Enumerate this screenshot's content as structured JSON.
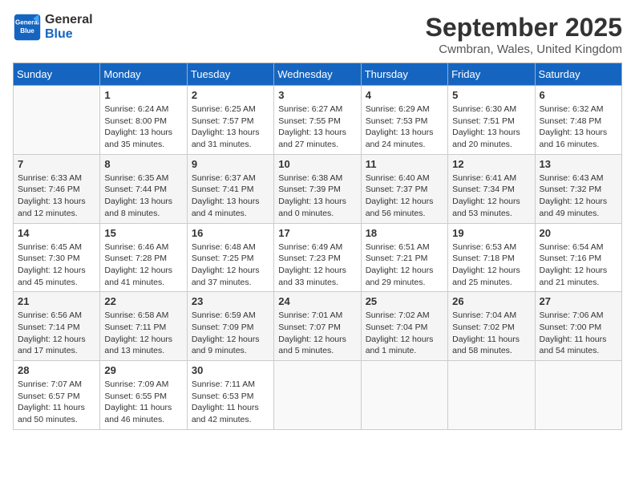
{
  "logo": {
    "line1": "General",
    "line2": "Blue"
  },
  "title": "September 2025",
  "location": "Cwmbran, Wales, United Kingdom",
  "days_of_week": [
    "Sunday",
    "Monday",
    "Tuesday",
    "Wednesday",
    "Thursday",
    "Friday",
    "Saturday"
  ],
  "weeks": [
    [
      {
        "day": "",
        "empty": true
      },
      {
        "day": "1",
        "sunrise": "6:24 AM",
        "sunset": "8:00 PM",
        "daylight": "13 hours and 35 minutes."
      },
      {
        "day": "2",
        "sunrise": "6:25 AM",
        "sunset": "7:57 PM",
        "daylight": "13 hours and 31 minutes."
      },
      {
        "day": "3",
        "sunrise": "6:27 AM",
        "sunset": "7:55 PM",
        "daylight": "13 hours and 27 minutes."
      },
      {
        "day": "4",
        "sunrise": "6:29 AM",
        "sunset": "7:53 PM",
        "daylight": "13 hours and 24 minutes."
      },
      {
        "day": "5",
        "sunrise": "6:30 AM",
        "sunset": "7:51 PM",
        "daylight": "13 hours and 20 minutes."
      },
      {
        "day": "6",
        "sunrise": "6:32 AM",
        "sunset": "7:48 PM",
        "daylight": "13 hours and 16 minutes."
      }
    ],
    [
      {
        "day": "7",
        "sunrise": "6:33 AM",
        "sunset": "7:46 PM",
        "daylight": "13 hours and 12 minutes."
      },
      {
        "day": "8",
        "sunrise": "6:35 AM",
        "sunset": "7:44 PM",
        "daylight": "13 hours and 8 minutes."
      },
      {
        "day": "9",
        "sunrise": "6:37 AM",
        "sunset": "7:41 PM",
        "daylight": "13 hours and 4 minutes."
      },
      {
        "day": "10",
        "sunrise": "6:38 AM",
        "sunset": "7:39 PM",
        "daylight": "13 hours and 0 minutes."
      },
      {
        "day": "11",
        "sunrise": "6:40 AM",
        "sunset": "7:37 PM",
        "daylight": "12 hours and 56 minutes."
      },
      {
        "day": "12",
        "sunrise": "6:41 AM",
        "sunset": "7:34 PM",
        "daylight": "12 hours and 53 minutes."
      },
      {
        "day": "13",
        "sunrise": "6:43 AM",
        "sunset": "7:32 PM",
        "daylight": "12 hours and 49 minutes."
      }
    ],
    [
      {
        "day": "14",
        "sunrise": "6:45 AM",
        "sunset": "7:30 PM",
        "daylight": "12 hours and 45 minutes."
      },
      {
        "day": "15",
        "sunrise": "6:46 AM",
        "sunset": "7:28 PM",
        "daylight": "12 hours and 41 minutes."
      },
      {
        "day": "16",
        "sunrise": "6:48 AM",
        "sunset": "7:25 PM",
        "daylight": "12 hours and 37 minutes."
      },
      {
        "day": "17",
        "sunrise": "6:49 AM",
        "sunset": "7:23 PM",
        "daylight": "12 hours and 33 minutes."
      },
      {
        "day": "18",
        "sunrise": "6:51 AM",
        "sunset": "7:21 PM",
        "daylight": "12 hours and 29 minutes."
      },
      {
        "day": "19",
        "sunrise": "6:53 AM",
        "sunset": "7:18 PM",
        "daylight": "12 hours and 25 minutes."
      },
      {
        "day": "20",
        "sunrise": "6:54 AM",
        "sunset": "7:16 PM",
        "daylight": "12 hours and 21 minutes."
      }
    ],
    [
      {
        "day": "21",
        "sunrise": "6:56 AM",
        "sunset": "7:14 PM",
        "daylight": "12 hours and 17 minutes."
      },
      {
        "day": "22",
        "sunrise": "6:58 AM",
        "sunset": "7:11 PM",
        "daylight": "12 hours and 13 minutes."
      },
      {
        "day": "23",
        "sunrise": "6:59 AM",
        "sunset": "7:09 PM",
        "daylight": "12 hours and 9 minutes."
      },
      {
        "day": "24",
        "sunrise": "7:01 AM",
        "sunset": "7:07 PM",
        "daylight": "12 hours and 5 minutes."
      },
      {
        "day": "25",
        "sunrise": "7:02 AM",
        "sunset": "7:04 PM",
        "daylight": "12 hours and 1 minute."
      },
      {
        "day": "26",
        "sunrise": "7:04 AM",
        "sunset": "7:02 PM",
        "daylight": "11 hours and 58 minutes."
      },
      {
        "day": "27",
        "sunrise": "7:06 AM",
        "sunset": "7:00 PM",
        "daylight": "11 hours and 54 minutes."
      }
    ],
    [
      {
        "day": "28",
        "sunrise": "7:07 AM",
        "sunset": "6:57 PM",
        "daylight": "11 hours and 50 minutes."
      },
      {
        "day": "29",
        "sunrise": "7:09 AM",
        "sunset": "6:55 PM",
        "daylight": "11 hours and 46 minutes."
      },
      {
        "day": "30",
        "sunrise": "7:11 AM",
        "sunset": "6:53 PM",
        "daylight": "11 hours and 42 minutes."
      },
      {
        "day": "",
        "empty": true
      },
      {
        "day": "",
        "empty": true
      },
      {
        "day": "",
        "empty": true
      },
      {
        "day": "",
        "empty": true
      }
    ]
  ],
  "labels": {
    "sunrise": "Sunrise:",
    "sunset": "Sunset:",
    "daylight": "Daylight:"
  }
}
